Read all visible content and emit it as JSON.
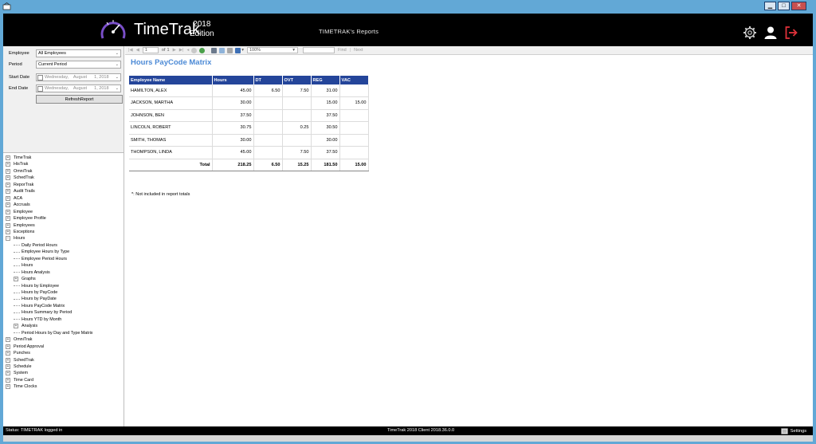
{
  "window": {
    "buttons": {
      "minimize": "▁",
      "maximize": "□",
      "close": "✕"
    }
  },
  "header": {
    "logo_text": "TimeTrak",
    "year": "2018",
    "edition": "Edition",
    "title": "TIMETRAK's Reports",
    "icons": [
      "gear-icon",
      "user-icon",
      "logout-icon"
    ],
    "logout_color": "#e0313a"
  },
  "params": {
    "employee_label": "Employee",
    "employee_value": "All Employees",
    "period_label": "Period",
    "period_value": "Current Period",
    "start_label": "Start Date",
    "start_value": "Wednesday,    August      1, 2018",
    "end_label": "End Date",
    "end_value": "Wednesday,    August      1, 2018",
    "refresh_label": "RefreshReport"
  },
  "tree": {
    "top": [
      "TimeTrak",
      "HisTrak",
      "OmniTrak",
      "SchedTrak",
      "ReporTrak",
      "Audit Trails",
      "ACA",
      "Accruals",
      "Employee",
      "Employee Profile",
      "Employees",
      "Exceptions",
      "Hours"
    ],
    "hours_children": [
      "Daily Period Hours",
      "Employee Hours by Type",
      "Employee Period Hours",
      "Hours",
      "Hours Analysis",
      "Graphs",
      "Hours by Employee",
      "Hours by PayCode",
      "Hours by PayDate",
      "Hours PayCode Matrix",
      "Hours Summary by Period",
      "Hours YTD by Month",
      "Analysis",
      "Period Hours by Day and Type Matrix"
    ],
    "bottom": [
      "OmniTrak",
      "Period Approval",
      "Punches",
      "SchedTrak",
      "Schedule",
      "System",
      "Time Card",
      "Time Clocks"
    ]
  },
  "toolbar": {
    "page": "1",
    "of_label": "of",
    "total_pages": "1",
    "zoom": "100%",
    "find_label": "Find",
    "next_label": "Next"
  },
  "report": {
    "title": "Hours PayCode Matrix",
    "columns": [
      "Employee Name",
      "Hours",
      "DT",
      "OVT",
      "REG",
      "VAC"
    ],
    "rows": [
      [
        "HAMILTON, ALEX",
        "45.00",
        "6.50",
        "7.50",
        "31.00",
        ""
      ],
      [
        "JACKSON, MARTHA",
        "30.00",
        "",
        "",
        "15.00",
        "15.00"
      ],
      [
        "JOHNSON, BEN",
        "37.50",
        "",
        "",
        "37.50",
        ""
      ],
      [
        "LINCOLN, ROBERT",
        "30.75",
        "",
        "0.25",
        "30.50",
        ""
      ],
      [
        "SMITH, THOMAS",
        "30.00",
        "",
        "",
        "30.00",
        ""
      ],
      [
        "THOMPSON, LINDA",
        "45.00",
        "",
        "7.50",
        "37.50",
        ""
      ]
    ],
    "total": [
      "Total",
      "218.25",
      "6.50",
      "15.25",
      "181.50",
      "15.00"
    ],
    "footnote": "*: Not included in report totals"
  },
  "status": {
    "left": "Status: TIMETRAK logged in",
    "middle": "TimeTrak 2018 Client 2018.36.0.0",
    "settings": "Settings"
  }
}
